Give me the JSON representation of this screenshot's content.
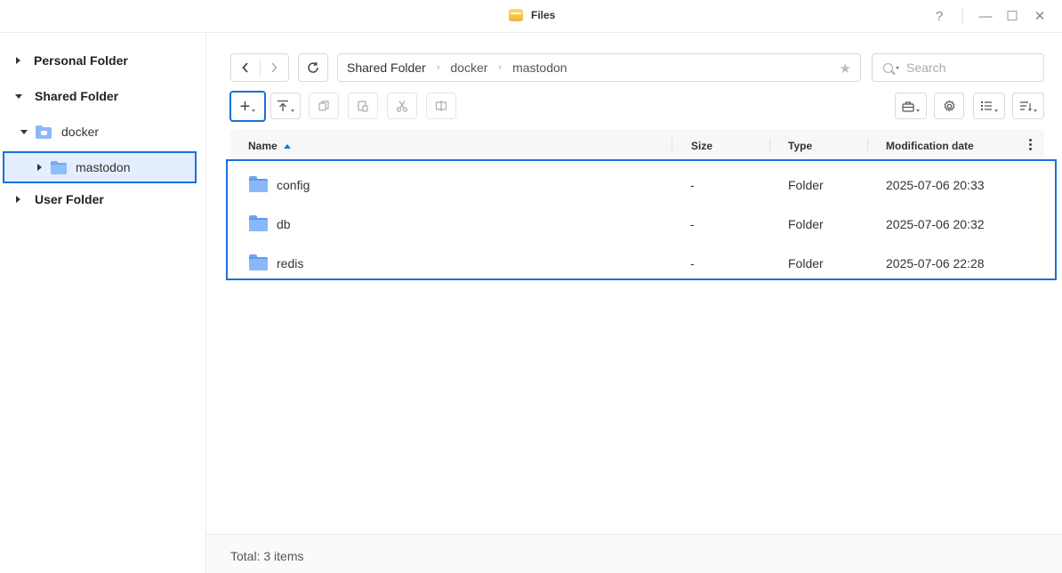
{
  "window": {
    "title": "Files",
    "help_label": "?",
    "minimize_label": "—",
    "maximize_label": "☐",
    "close_label": "✕"
  },
  "sidebar": {
    "items": [
      {
        "label": "Personal Folder",
        "expanded": false
      },
      {
        "label": "Shared Folder",
        "expanded": true
      },
      {
        "label": "docker",
        "expanded": true
      },
      {
        "label": "mastodon",
        "expanded": false,
        "selected": true
      },
      {
        "label": "User Folder",
        "expanded": false
      }
    ]
  },
  "toolbar": {
    "back_icon": "chevron-left-icon",
    "forward_icon": "chevron-right-icon",
    "refresh_icon": "refresh-icon",
    "create_label": "+",
    "upload_icon": "upload-icon",
    "copy_icon": "copy-icon",
    "paste_icon": "paste-icon",
    "cut_icon": "scissors-icon",
    "rename_icon": "rename-icon",
    "tools_icon": "toolbox-icon",
    "settings_icon": "gear-icon",
    "view_icon": "list-view-icon",
    "sort_icon": "sort-icon"
  },
  "path": {
    "crumbs": [
      "Shared Folder",
      "docker",
      "mastodon"
    ],
    "separator": "›"
  },
  "search": {
    "placeholder": "Search",
    "value": ""
  },
  "table": {
    "columns": [
      {
        "label": "Name",
        "sorted": "asc"
      },
      {
        "label": "Size"
      },
      {
        "label": "Type"
      },
      {
        "label": "Modification date"
      }
    ],
    "rows": [
      {
        "name": "config",
        "size": "-",
        "type": "Folder",
        "modified": "2025-07-06 20:33"
      },
      {
        "name": "db",
        "size": "-",
        "type": "Folder",
        "modified": "2025-07-06 20:32"
      },
      {
        "name": "redis",
        "size": "-",
        "type": "Folder",
        "modified": "2025-07-06 22:28"
      }
    ]
  },
  "footer": {
    "status": "Total: 3 items"
  },
  "colors": {
    "accent": "#1a6fe0",
    "folder": "#6fa6f3",
    "app_icon": "#f0b637"
  }
}
